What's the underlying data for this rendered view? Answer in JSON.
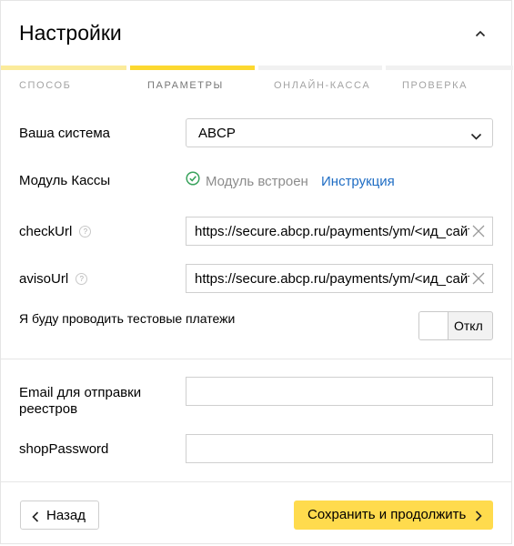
{
  "header": {
    "title": "Настройки",
    "collapse_icon": "chevron-up-icon"
  },
  "steps": {
    "progress_colors": {
      "done": "#fbeb9b",
      "active": "#fcd830",
      "pending": "#f1f1f1"
    },
    "labels": [
      "СПОСОБ",
      "ПАРАМЕТРЫ",
      "ОНЛАЙН-КАССА",
      "ПРОВЕРКА"
    ],
    "active_index": 1
  },
  "system": {
    "label": "Ваша система",
    "value": "ABCP"
  },
  "module": {
    "label": "Модуль Кассы",
    "status": "Модуль встроен",
    "status_color": "#3aa35d",
    "link": "Инструкция",
    "link_color": "#1f6dc4"
  },
  "checkUrl": {
    "label": "checkUrl",
    "help": "?",
    "value": "https://secure.abcp.ru/payments/ym/<ид_сайт"
  },
  "avisoUrl": {
    "label": "avisoUrl",
    "help": "?",
    "value": "https://secure.abcp.ru/payments/ym/<ид_сайт"
  },
  "test_payments": {
    "label": "Я буду проводить тестовые платежи",
    "toggle_label": "Откл"
  },
  "email": {
    "label": "Email для отправки реестров",
    "value": ""
  },
  "shopPassword": {
    "label": "shopPassword",
    "value": ""
  },
  "footer": {
    "back_label": "Назад",
    "save_label": "Сохранить и продолжить",
    "save_color": "#ffdb4d"
  }
}
